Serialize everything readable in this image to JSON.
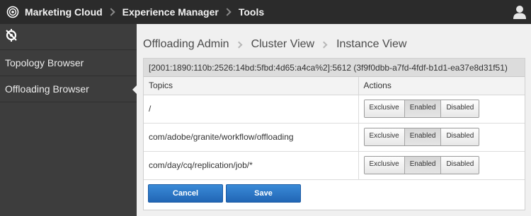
{
  "topbar": {
    "breadcrumbs": [
      "Marketing Cloud",
      "Experience Manager",
      "Tools"
    ],
    "logo_icon": "adobe-marketing-cloud-logo",
    "user_icon": "user-icon"
  },
  "sidebar": {
    "header_icon": "tools-hammer-icon",
    "items": [
      {
        "label": "Topology Browser",
        "active": false
      },
      {
        "label": "Offloading Browser",
        "active": true
      }
    ]
  },
  "main": {
    "breadcrumb": [
      "Offloading Admin",
      "Cluster View",
      "Instance View"
    ],
    "instance_id": "[2001:1890:110b:2526:14bd:5fbd:4d65:a4ca%2]:5612 (3f9f0dbb-a7fd-4fdf-b1d1-ea37e8d31f51)",
    "table": {
      "headers": [
        "Topics",
        "Actions"
      ],
      "action_labels": [
        "Exclusive",
        "Enabled",
        "Disabled"
      ],
      "rows": [
        {
          "topic": "/",
          "selected": "Enabled"
        },
        {
          "topic": "com/adobe/granite/workflow/offloading",
          "selected": "Enabled"
        },
        {
          "topic": "com/day/cq/replication/job/*",
          "selected": "Enabled"
        }
      ]
    },
    "buttons": {
      "cancel": "Cancel",
      "save": "Save"
    }
  },
  "colors": {
    "topbar": "#2b2b2b",
    "sidebar": "#3d3d3d",
    "primary_button": "#2a75c6"
  }
}
